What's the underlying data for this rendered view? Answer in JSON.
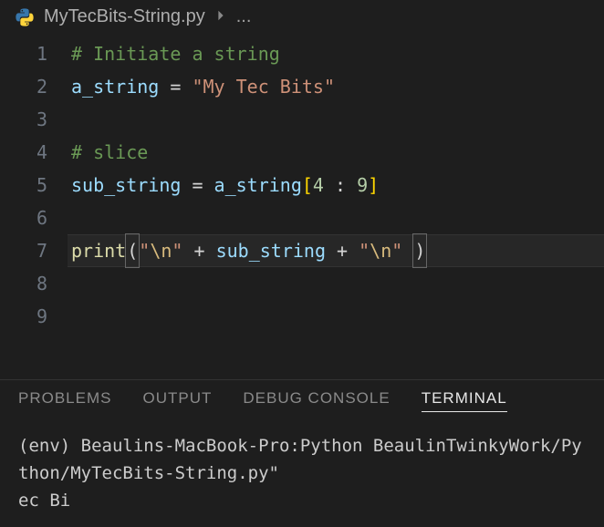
{
  "breadcrumb": {
    "filename": "MyTecBits-String.py",
    "ellipsis": "..."
  },
  "editor": {
    "lines": [
      {
        "num": "1",
        "tokens": [
          {
            "cls": "tok-comment",
            "t": "# Initiate a string"
          }
        ]
      },
      {
        "num": "2",
        "tokens": [
          {
            "cls": "tok-var",
            "t": "a_string"
          },
          {
            "cls": "tok-op",
            "t": " = "
          },
          {
            "cls": "tok-str",
            "t": "\"My Tec Bits\""
          }
        ]
      },
      {
        "num": "3",
        "tokens": []
      },
      {
        "num": "4",
        "tokens": [
          {
            "cls": "tok-comment",
            "t": "# slice"
          }
        ]
      },
      {
        "num": "5",
        "tokens": [
          {
            "cls": "tok-var",
            "t": "sub_string"
          },
          {
            "cls": "tok-op",
            "t": " = "
          },
          {
            "cls": "tok-var",
            "t": "a_string"
          },
          {
            "cls": "tok-bracket",
            "t": "["
          },
          {
            "cls": "tok-num",
            "t": "4"
          },
          {
            "cls": "tok-op",
            "t": " : "
          },
          {
            "cls": "tok-num",
            "t": "9"
          },
          {
            "cls": "tok-bracket",
            "t": "]"
          }
        ]
      },
      {
        "num": "6",
        "tokens": []
      },
      {
        "num": "7",
        "current": true,
        "tokens": [
          {
            "cls": "tok-func",
            "t": "print"
          },
          {
            "cls": "tok-paren bracket-box",
            "t": "("
          },
          {
            "cls": "tok-str",
            "t": "\""
          },
          {
            "cls": "tok-esc",
            "t": "\\n"
          },
          {
            "cls": "tok-str",
            "t": "\""
          },
          {
            "cls": "tok-op",
            "t": " + "
          },
          {
            "cls": "tok-var",
            "t": "sub_string"
          },
          {
            "cls": "tok-op",
            "t": " + "
          },
          {
            "cls": "tok-str",
            "t": "\""
          },
          {
            "cls": "tok-esc",
            "t": "\\n"
          },
          {
            "cls": "tok-str",
            "t": "\""
          },
          {
            "cls": "tok-op",
            "t": " "
          },
          {
            "cls": "tok-paren bracket-box",
            "t": ")"
          }
        ]
      },
      {
        "num": "8",
        "tokens": []
      },
      {
        "num": "9",
        "tokens": []
      }
    ]
  },
  "panel": {
    "tabs": {
      "problems": "PROBLEMS",
      "output": "OUTPUT",
      "debug": "DEBUG CONSOLE",
      "terminal": "TERMINAL"
    }
  },
  "terminal": {
    "line1": "(env) Beaulins-MacBook-Pro:Python BeaulinTwinkyWork/Python/MyTecBits-String.py\"",
    "blank": "",
    "line2": "ec Bi"
  }
}
